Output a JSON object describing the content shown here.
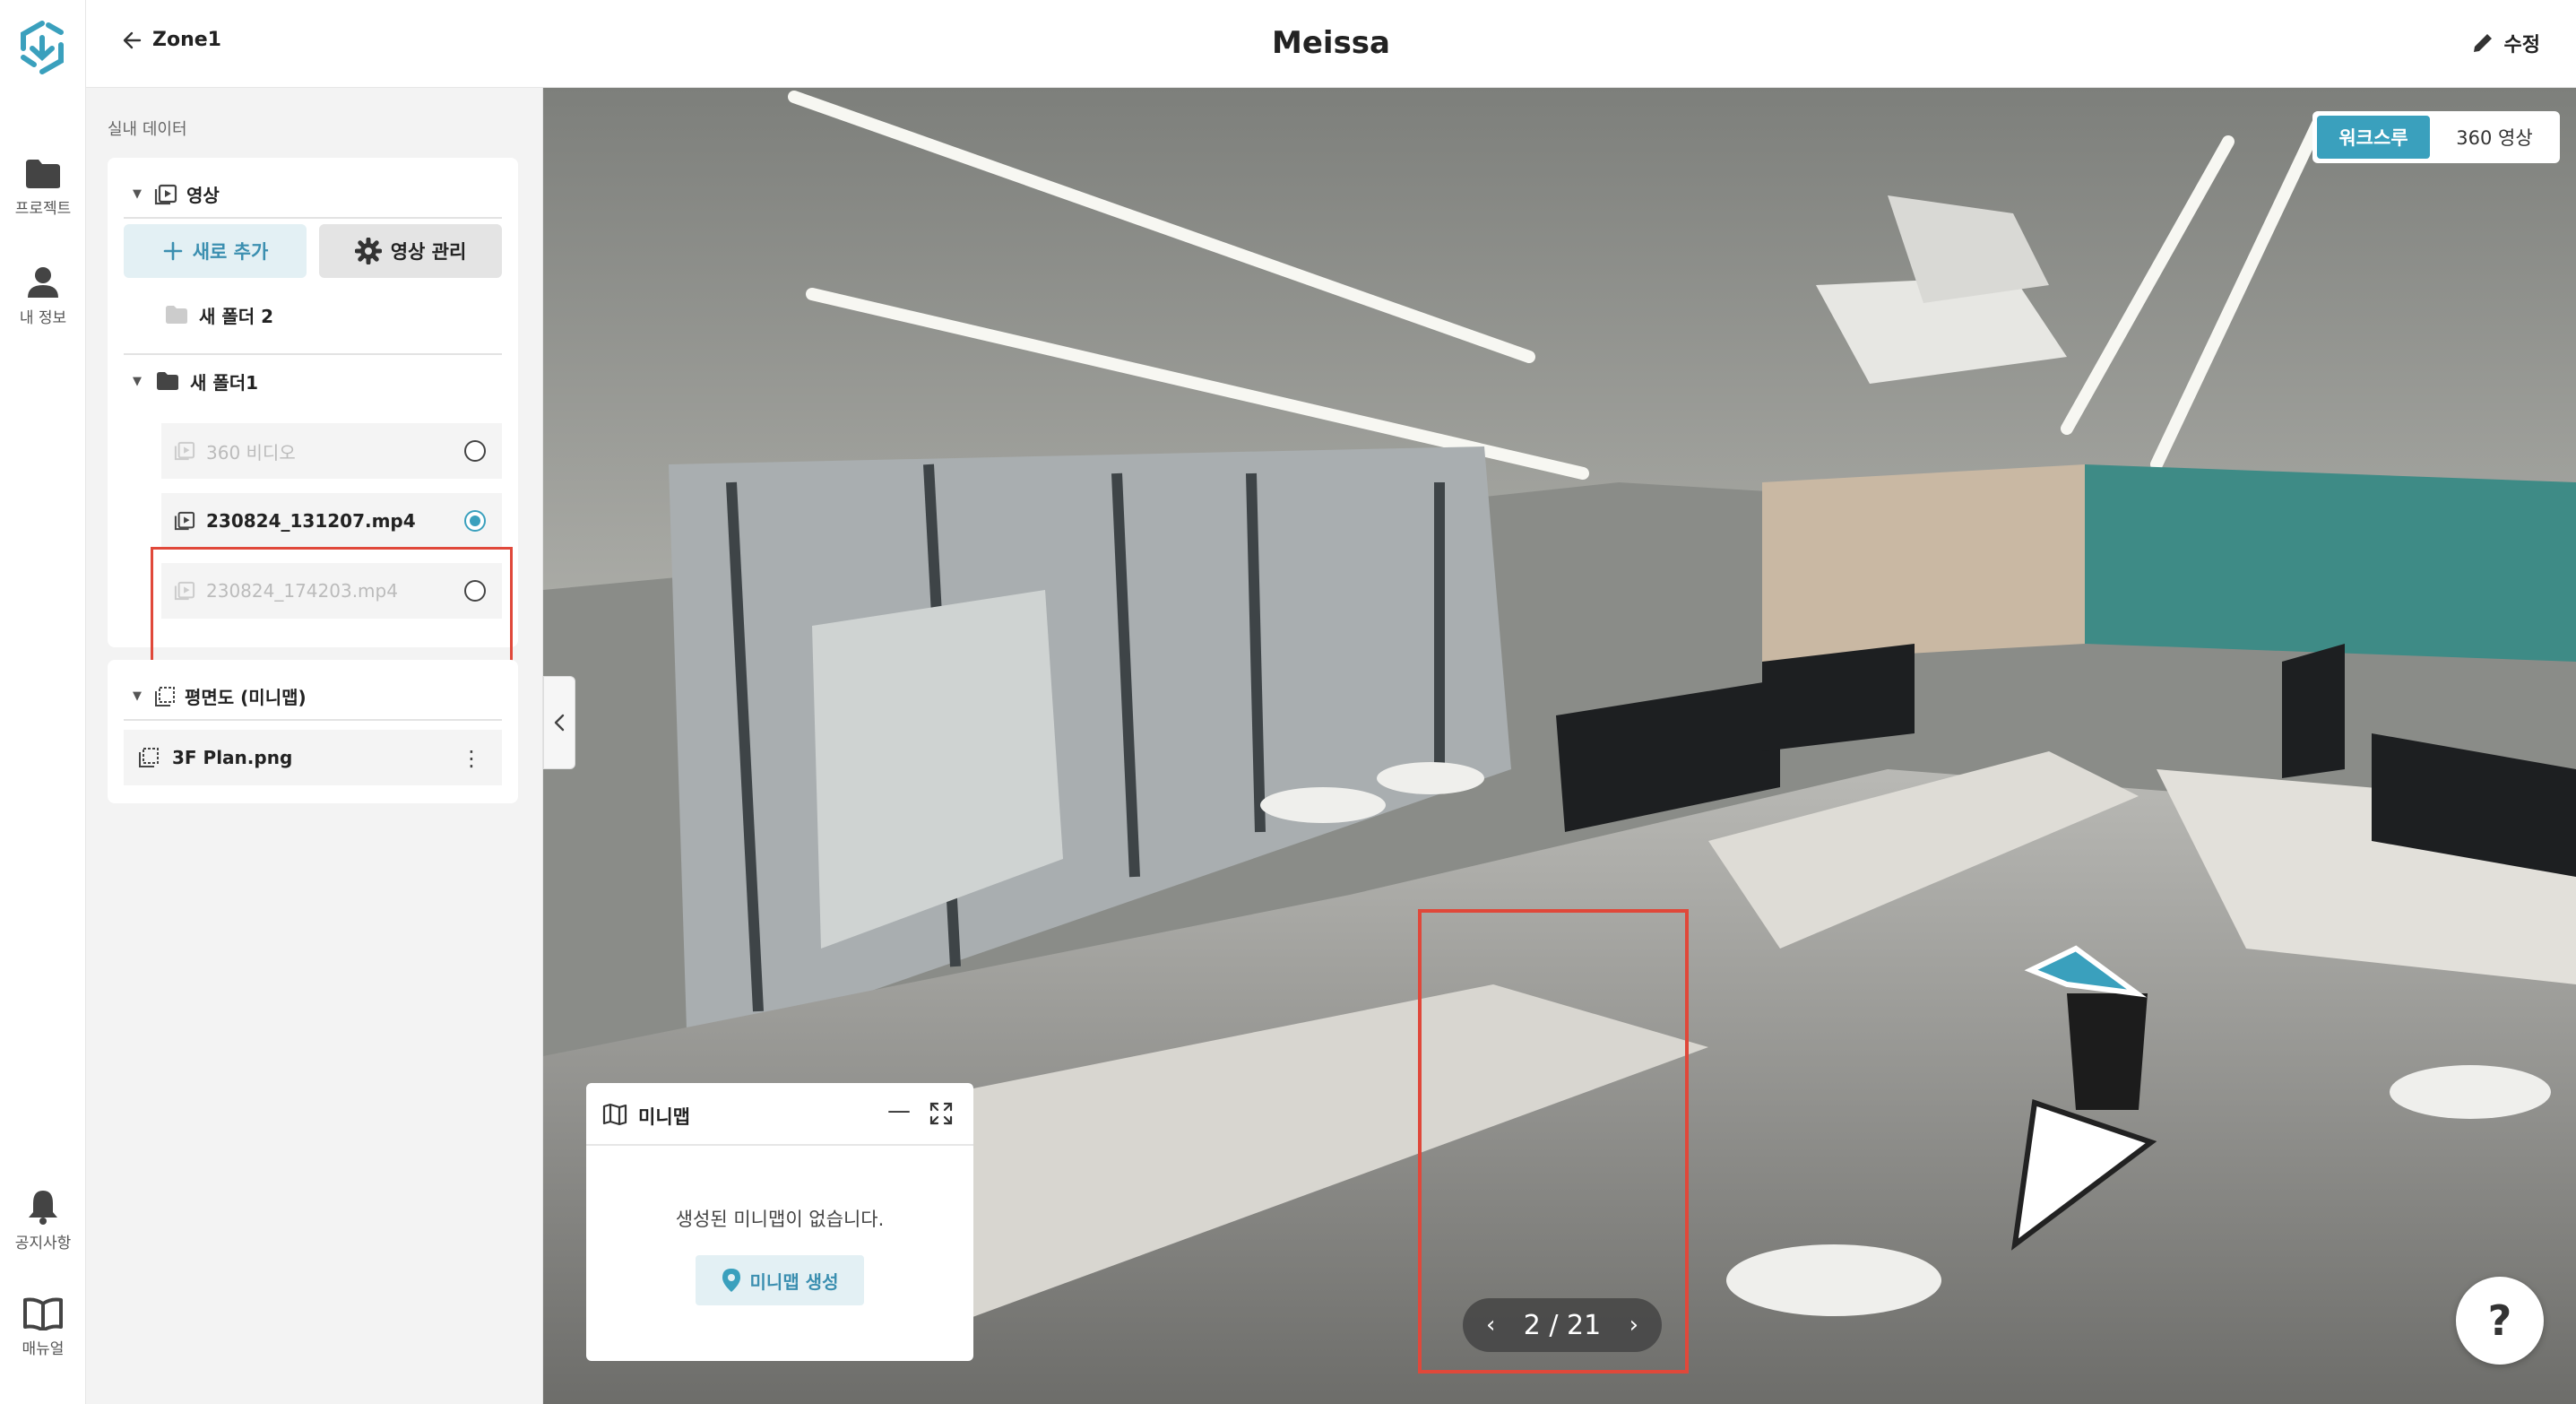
{
  "rail": {
    "items": [
      {
        "label": "프로젝트",
        "icon": "folder-icon"
      },
      {
        "label": "내 정보",
        "icon": "user-icon"
      },
      {
        "label": "공지사항",
        "icon": "bell-icon"
      },
      {
        "label": "매뉴얼",
        "icon": "book-icon"
      }
    ]
  },
  "header": {
    "back_label": "Zone1",
    "title": "Meissa",
    "edit_label": "수정"
  },
  "panel": {
    "label": "실내 데이터",
    "video_section": {
      "title": "영상",
      "add_label": "새로 추가",
      "manage_label": "영상 관리",
      "folders": [
        {
          "name": "새 폴더 2"
        },
        {
          "name": "새 폴더1",
          "files": [
            "360 비디오",
            "230824_131207.mp4",
            "230824_174203.mp4"
          ],
          "selected": "230824_131207.mp4"
        }
      ]
    },
    "plan_section": {
      "title": "평면도 (미니맵)",
      "file": "3F Plan.png"
    }
  },
  "viewer": {
    "mode_options": [
      "워크스루",
      "360 영상"
    ],
    "active_mode": "워크스루",
    "pager": {
      "current": 2,
      "total": 21,
      "text": "2 / 21"
    },
    "help_label": "?"
  },
  "minimap": {
    "title": "미니맵",
    "empty_text": "생성된 미니맵이 없습니다.",
    "create_label": "미니맵 생성"
  },
  "colors": {
    "accent": "#3aa0bd",
    "highlight": "#e0483a"
  }
}
